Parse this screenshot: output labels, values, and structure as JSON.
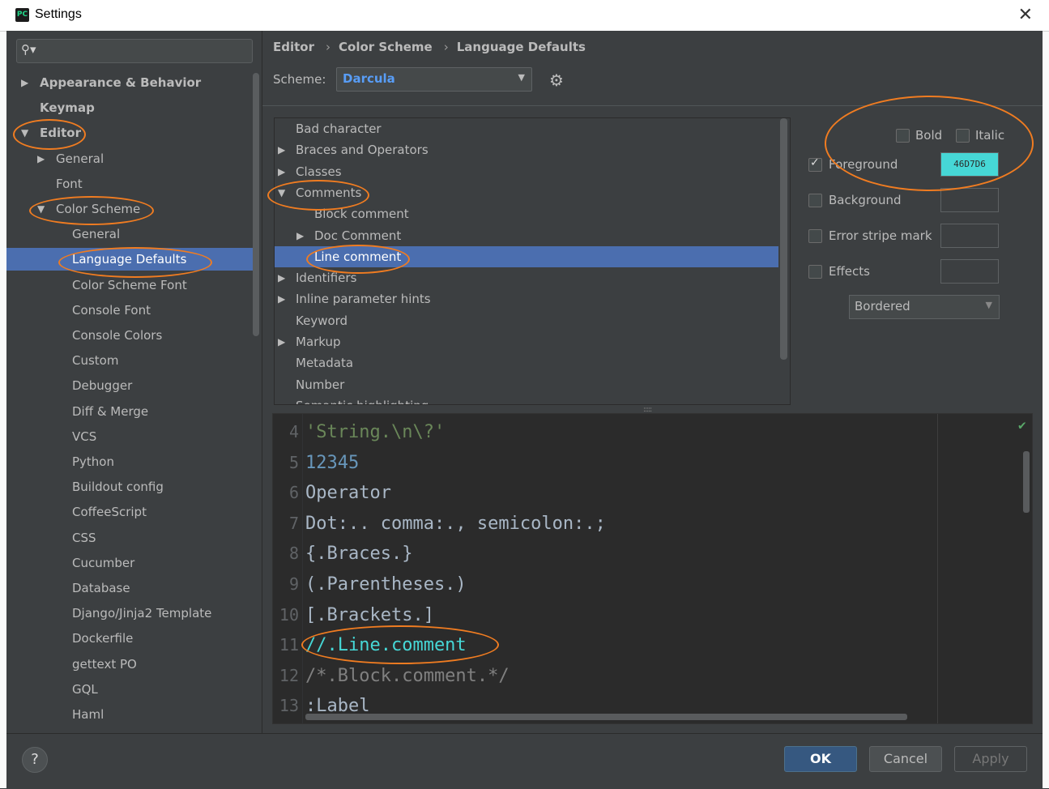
{
  "window": {
    "title": "Settings",
    "app_icon": "PC"
  },
  "sidebar": {
    "items": [
      {
        "label": "Appearance & Behavior",
        "arrow": "right",
        "bold": true
      },
      {
        "label": "Keymap",
        "arrow": "",
        "bold": true
      },
      {
        "label": "Editor",
        "arrow": "down",
        "bold": true
      },
      {
        "label": "General",
        "arrow": "right"
      },
      {
        "label": "Font",
        "arrow": ""
      },
      {
        "label": "Color Scheme",
        "arrow": "down"
      },
      {
        "label": "General",
        "arrow": ""
      },
      {
        "label": "Language Defaults",
        "arrow": "",
        "selected": true
      },
      {
        "label": "Color Scheme Font",
        "arrow": ""
      },
      {
        "label": "Console Font",
        "arrow": ""
      },
      {
        "label": "Console Colors",
        "arrow": ""
      },
      {
        "label": "Custom",
        "arrow": ""
      },
      {
        "label": "Debugger",
        "arrow": ""
      },
      {
        "label": "Diff & Merge",
        "arrow": ""
      },
      {
        "label": "VCS",
        "arrow": ""
      },
      {
        "label": "Python",
        "arrow": ""
      },
      {
        "label": "Buildout config",
        "arrow": ""
      },
      {
        "label": "CoffeeScript",
        "arrow": ""
      },
      {
        "label": "CSS",
        "arrow": ""
      },
      {
        "label": "Cucumber",
        "arrow": ""
      },
      {
        "label": "Database",
        "arrow": ""
      },
      {
        "label": "Django/Jinja2 Template",
        "arrow": ""
      },
      {
        "label": "Dockerfile",
        "arrow": ""
      },
      {
        "label": "gettext PO",
        "arrow": ""
      },
      {
        "label": "GQL",
        "arrow": ""
      },
      {
        "label": "Haml",
        "arrow": ""
      }
    ]
  },
  "breadcrumb": [
    "Editor",
    "Color Scheme",
    "Language Defaults"
  ],
  "scheme": {
    "label": "Scheme:",
    "value": "Darcula"
  },
  "attributes": [
    {
      "label": "Bad character",
      "arrow": ""
    },
    {
      "label": "Braces and Operators",
      "arrow": "right"
    },
    {
      "label": "Classes",
      "arrow": "right"
    },
    {
      "label": "Comments",
      "arrow": "down"
    },
    {
      "label": "Block comment",
      "arrow": ""
    },
    {
      "label": "Doc Comment",
      "arrow": "right"
    },
    {
      "label": "Line comment",
      "arrow": "",
      "selected": true
    },
    {
      "label": "Identifiers",
      "arrow": "right"
    },
    {
      "label": "Inline parameter hints",
      "arrow": "right"
    },
    {
      "label": "Keyword",
      "arrow": ""
    },
    {
      "label": "Markup",
      "arrow": "right"
    },
    {
      "label": "Metadata",
      "arrow": ""
    },
    {
      "label": "Number",
      "arrow": ""
    },
    {
      "label": "Semantic highlighting",
      "arrow": ""
    }
  ],
  "properties": {
    "bold": "Bold",
    "italic": "Italic",
    "foreground": {
      "label": "Foreground",
      "checked": true,
      "color_text": "46D7D6"
    },
    "background": {
      "label": "Background",
      "checked": false
    },
    "error_stripe": {
      "label": "Error stripe mark",
      "checked": false
    },
    "effects": {
      "label": "Effects",
      "checked": false
    },
    "effect_type": "Bordered"
  },
  "preview": {
    "lines": [
      {
        "num": "4",
        "text": "'String.\\n\\?'",
        "color": "#6a8759"
      },
      {
        "num": "5",
        "text": "12345",
        "color": "#6897bb"
      },
      {
        "num": "6",
        "text": "Operator",
        "color": "#a9b7c6"
      },
      {
        "num": "7",
        "text": "Dot:.. comma:., semicolon:.;",
        "color": "#a9b7c6"
      },
      {
        "num": "8",
        "text": "{.Braces.}",
        "color": "#a9b7c6"
      },
      {
        "num": "9",
        "text": "(.Parentheses.)",
        "color": "#a9b7c6"
      },
      {
        "num": "10",
        "text": "[.Brackets.]",
        "color": "#a9b7c6"
      },
      {
        "num": "11",
        "text": "//.Line.comment",
        "color": "#46d7d6"
      },
      {
        "num": "12",
        "text": "/*.Block.comment.*/",
        "color": "#808080"
      },
      {
        "num": "13",
        "text": ":Label",
        "color": "#a9b7c6"
      }
    ]
  },
  "buttons": {
    "help": "?",
    "ok": "OK",
    "cancel": "Cancel",
    "apply": "Apply"
  },
  "colors": {
    "accent": "#4b6eaf",
    "annotation": "#f07c21",
    "foreground_swatch": "#46d7d6"
  }
}
